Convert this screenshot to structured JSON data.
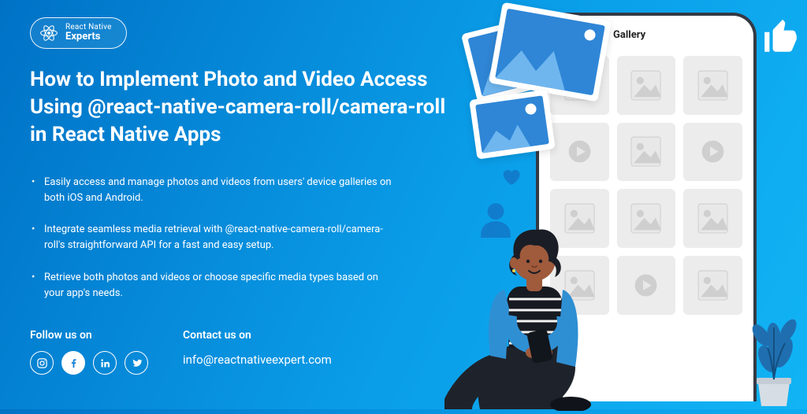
{
  "badge": {
    "line1": "React Native",
    "line2": "Experts"
  },
  "title": "How to Implement Photo and Video Access Using @react-native-camera-roll/camera-roll in React Native Apps",
  "bullets": [
    "Easily access and manage photos and videos from users' device galleries on both iOS and Android.",
    "Integrate seamless media retrieval with @react-native-camera-roll/camera-roll's straightforward API for a fast and easy setup.",
    "Retrieve both photos and videos or choose specific media types based on your app's needs."
  ],
  "follow": {
    "heading": "Follow us on"
  },
  "contact": {
    "heading": "Contact us on",
    "email": "info@reactnativeexpert.com"
  },
  "phone": {
    "back": "←",
    "title": "Gallery",
    "tiles": [
      "img",
      "img",
      "img",
      "play",
      "img",
      "play",
      "img",
      "img",
      "img",
      "img",
      "play",
      "img"
    ]
  }
}
